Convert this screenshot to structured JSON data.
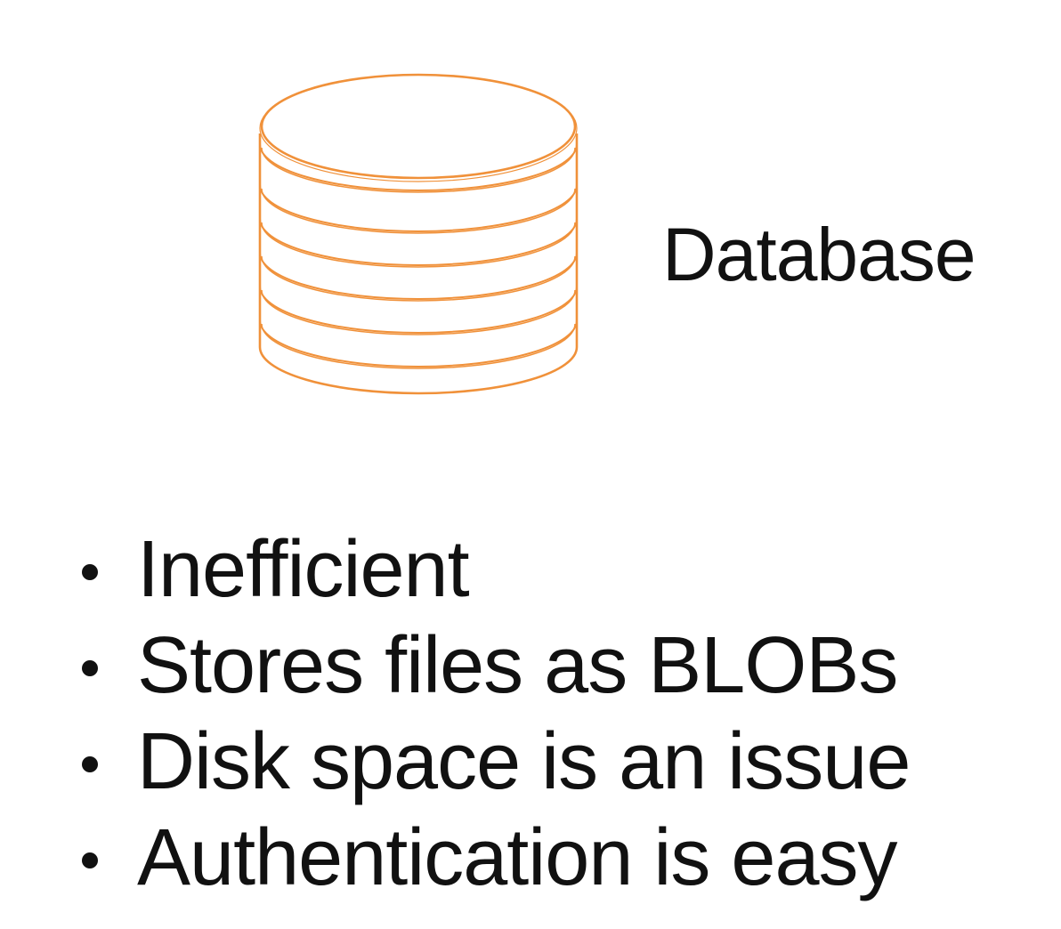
{
  "diagram": {
    "icon": "database-icon",
    "icon_color": "#F0913A",
    "label": "Database"
  },
  "bullets": [
    "Inefficient",
    "Stores files as BLOBs",
    "Disk space is an issue",
    "Authentication is easy"
  ]
}
